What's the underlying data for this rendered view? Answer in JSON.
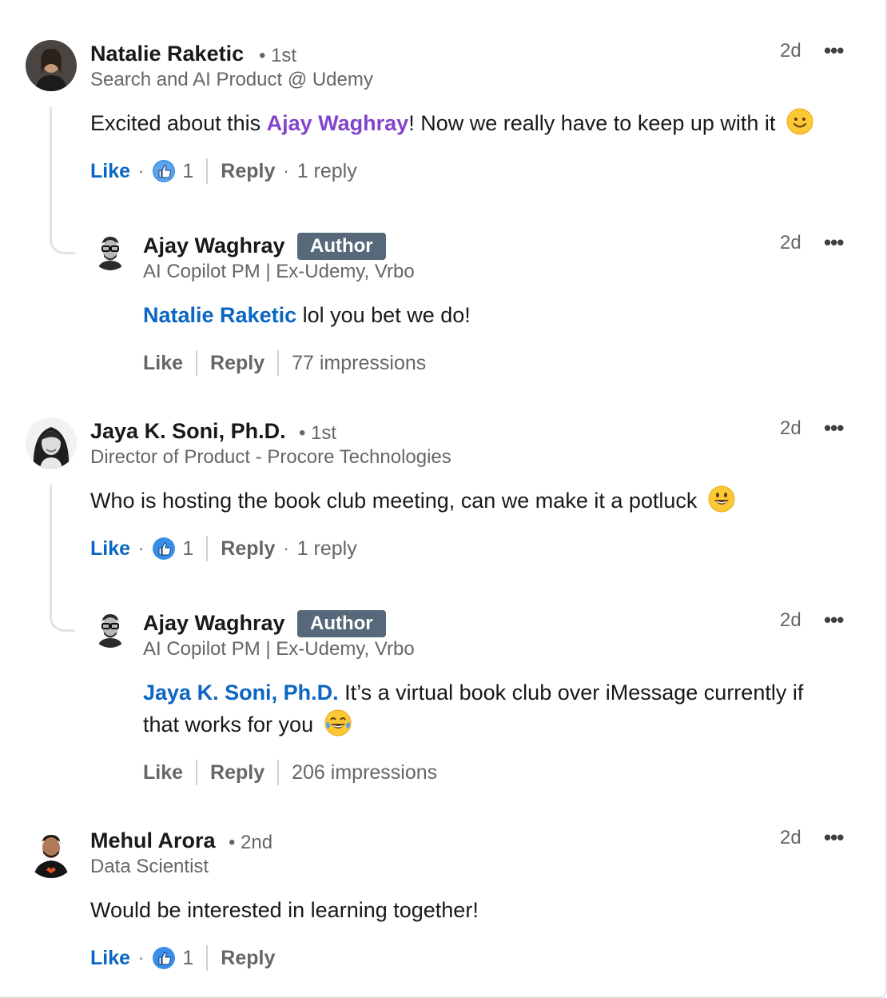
{
  "comments": [
    {
      "name": "Natalie Raketic",
      "degree": "• 1st",
      "headline": "Search and AI Product @ Udemy",
      "time": "2d",
      "text_before": "Excited about this ",
      "mention": "Ajay Waghray",
      "text_after": "! Now we really have to keep up with it",
      "like_label": "Like",
      "like_count": "1",
      "reply_label": "Reply",
      "reply_meta": "1 reply",
      "reply": {
        "name": "Ajay Waghray",
        "badge": "Author",
        "headline": "AI Copilot PM | Ex-Udemy, Vrbo",
        "time": "2d",
        "mention": "Natalie Raketic",
        "text": " lol you bet we do!",
        "like_label": "Like",
        "reply_label": "Reply",
        "impressions": "77 impressions"
      }
    },
    {
      "name": "Jaya K. Soni, Ph.D.",
      "degree": "• 1st",
      "headline": "Director of Product - Procore Technologies",
      "time": "2d",
      "text": "Who is hosting the book club meeting, can we make it a potluck",
      "like_label": "Like",
      "like_count": "1",
      "reply_label": "Reply",
      "reply_meta": "1 reply",
      "reply": {
        "name": "Ajay Waghray",
        "badge": "Author",
        "headline": "AI Copilot PM | Ex-Udemy, Vrbo",
        "time": "2d",
        "mention": "Jaya K. Soni, Ph.D.",
        "text_line1": " It’s a virtual book club over iMessage currently if",
        "text_line2": "that works for you",
        "like_label": "Like",
        "reply_label": "Reply",
        "impressions": "206 impressions"
      }
    },
    {
      "name": "Mehul Arora",
      "degree": "• 2nd",
      "headline": "Data Scientist",
      "time": "2d",
      "text": "Would be interested in learning together!",
      "like_label": "Like",
      "like_count": "1",
      "reply_label": "Reply"
    }
  ],
  "colors": {
    "link_blue": "#0a66c2",
    "mention_purple": "#8344cc",
    "badge_bg": "#56687a",
    "secondary_text": "#666666"
  },
  "icons": {
    "like_reaction": "thumbs-up-reaction-icon",
    "more": "more-options-icon",
    "emoji_smile": "slightly-smiling-face-emoji",
    "emoji_grin": "grinning-face-emoji",
    "emoji_joy": "face-with-tears-of-joy-emoji"
  },
  "more_glyph": "•••"
}
